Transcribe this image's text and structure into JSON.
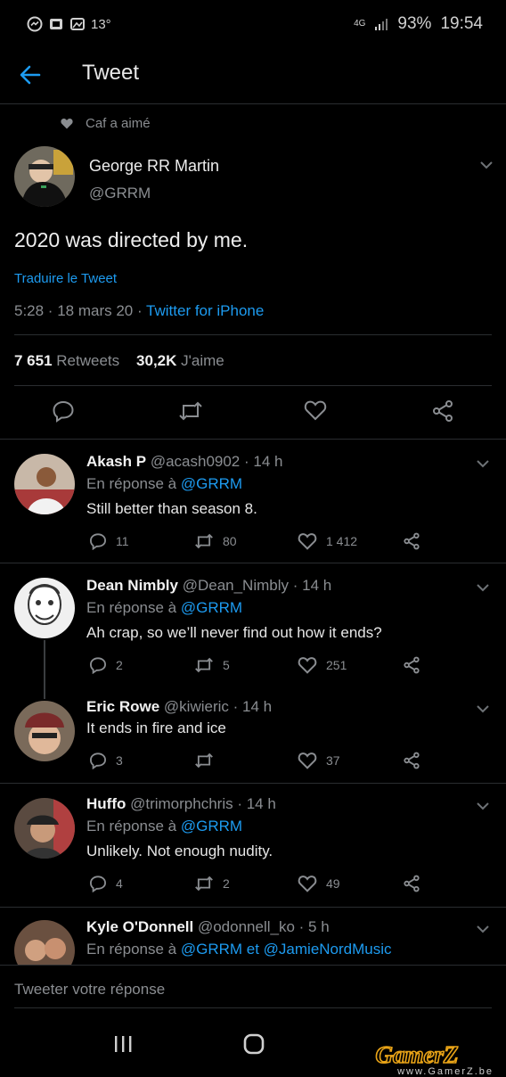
{
  "status_bar": {
    "temperature": "13°",
    "network": "4G",
    "battery": "93%",
    "time": "19:54"
  },
  "header": {
    "title": "Tweet"
  },
  "main_tweet": {
    "liked_by": "Caf a aimé",
    "name": "George RR Martin",
    "handle": "@GRRM",
    "text": "2020 was directed by me.",
    "translate": "Traduire le Tweet",
    "meta": "5:28 · 18 mars 20 · ",
    "source": "Twitter for iPhone",
    "retweets_count": "7 651",
    "retweets_label": " Retweets",
    "likes_count": "30,2K",
    "likes_label": " J'aime"
  },
  "replies": [
    {
      "name": "Akash P",
      "meta": " @acash0902 · 14 h",
      "reply_prefix": "En réponse à ",
      "reply_to": "@GRRM",
      "text": "Still better than season 8.",
      "replies": "11",
      "retweets": "80",
      "likes": "1 412"
    },
    {
      "name": "Dean Nimbly",
      "meta": " @Dean_Nimbly · 14 h",
      "reply_prefix": "En réponse à ",
      "reply_to": "@GRRM",
      "text": "Ah crap, so we’ll never find out how it ends?",
      "replies": "2",
      "retweets": "5",
      "likes": "251"
    },
    {
      "name": "Eric Rowe",
      "meta": " @kiwieric · 14 h",
      "text": "It ends in fire and ice",
      "replies": "3",
      "retweets": "",
      "likes": "37"
    },
    {
      "name": "Huffo",
      "meta": " @trimorphchris · 14 h",
      "reply_prefix": "En réponse à ",
      "reply_to": "@GRRM",
      "text": "Unlikely. Not enough nudity.",
      "replies": "4",
      "retweets": "2",
      "likes": "49"
    },
    {
      "name": "Kyle O'Donnell",
      "meta": " @odonnell_ko · 5 h",
      "reply_prefix": "En réponse à ",
      "reply_to": "@GRRM et @JamieNordMusic"
    }
  ],
  "compose": {
    "placeholder": "Tweeter votre réponse"
  },
  "watermark": {
    "logo": "GamerZ",
    "url": "www.GamerZ.be"
  },
  "colors": {
    "background": "#000000",
    "link": "#1d9bf0",
    "muted": "#8a8d91"
  }
}
